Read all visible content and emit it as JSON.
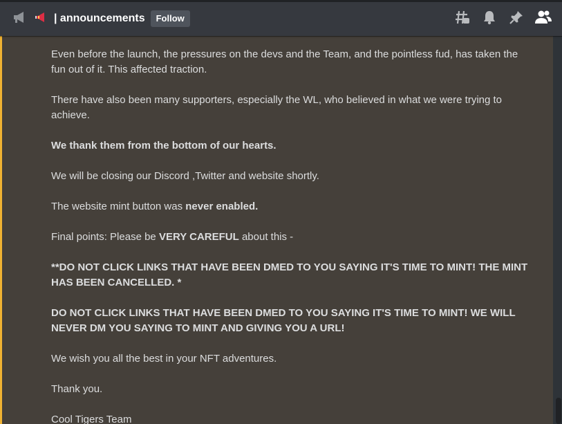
{
  "header": {
    "channel_name": "| announcements",
    "follow_label": "Follow",
    "icons": [
      "megaphone-icon",
      "announcement-emoji-icon",
      "threads-icon",
      "bell-icon",
      "pin-icon",
      "members-icon"
    ]
  },
  "message": {
    "p1": "Even before the launch, the pressures on the devs and the Team, and the pointless fud, has taken the fun out of it. This affected traction.",
    "p2": "There have also been many supporters, especially the WL, who believed in what we were trying to achieve.",
    "p3": "We thank them from the bottom of our hearts.",
    "p4": "We will be closing our Discord ,Twitter and website shortly.",
    "p5_a": "The website mint button was ",
    "p5_b": "never enabled.",
    "p6_a": "Final points:  Please be ",
    "p6_b": "VERY CAREFUL",
    "p6_c": " about this -",
    "p7": "**DO NOT CLICK LINKS THAT HAVE BEEN DMED TO YOU SAYING IT'S TIME TO MINT! THE MINT HAS BEEN CANCELLED. *",
    "p8": "DO NOT CLICK LINKS THAT HAVE BEEN DMED TO YOU SAYING IT'S TIME TO MINT! WE WILL NEVER DM YOU SAYING TO MINT AND GIVING YOU A URL!",
    "p9": "We wish you all the best in your NFT adventures.",
    "p10": "Thank you.",
    "p11": "Cool Tigers Team"
  },
  "colors": {
    "mention_highlight_bg": "#45403a",
    "mention_bar": "#f0b232",
    "header_bg": "#36393f"
  }
}
